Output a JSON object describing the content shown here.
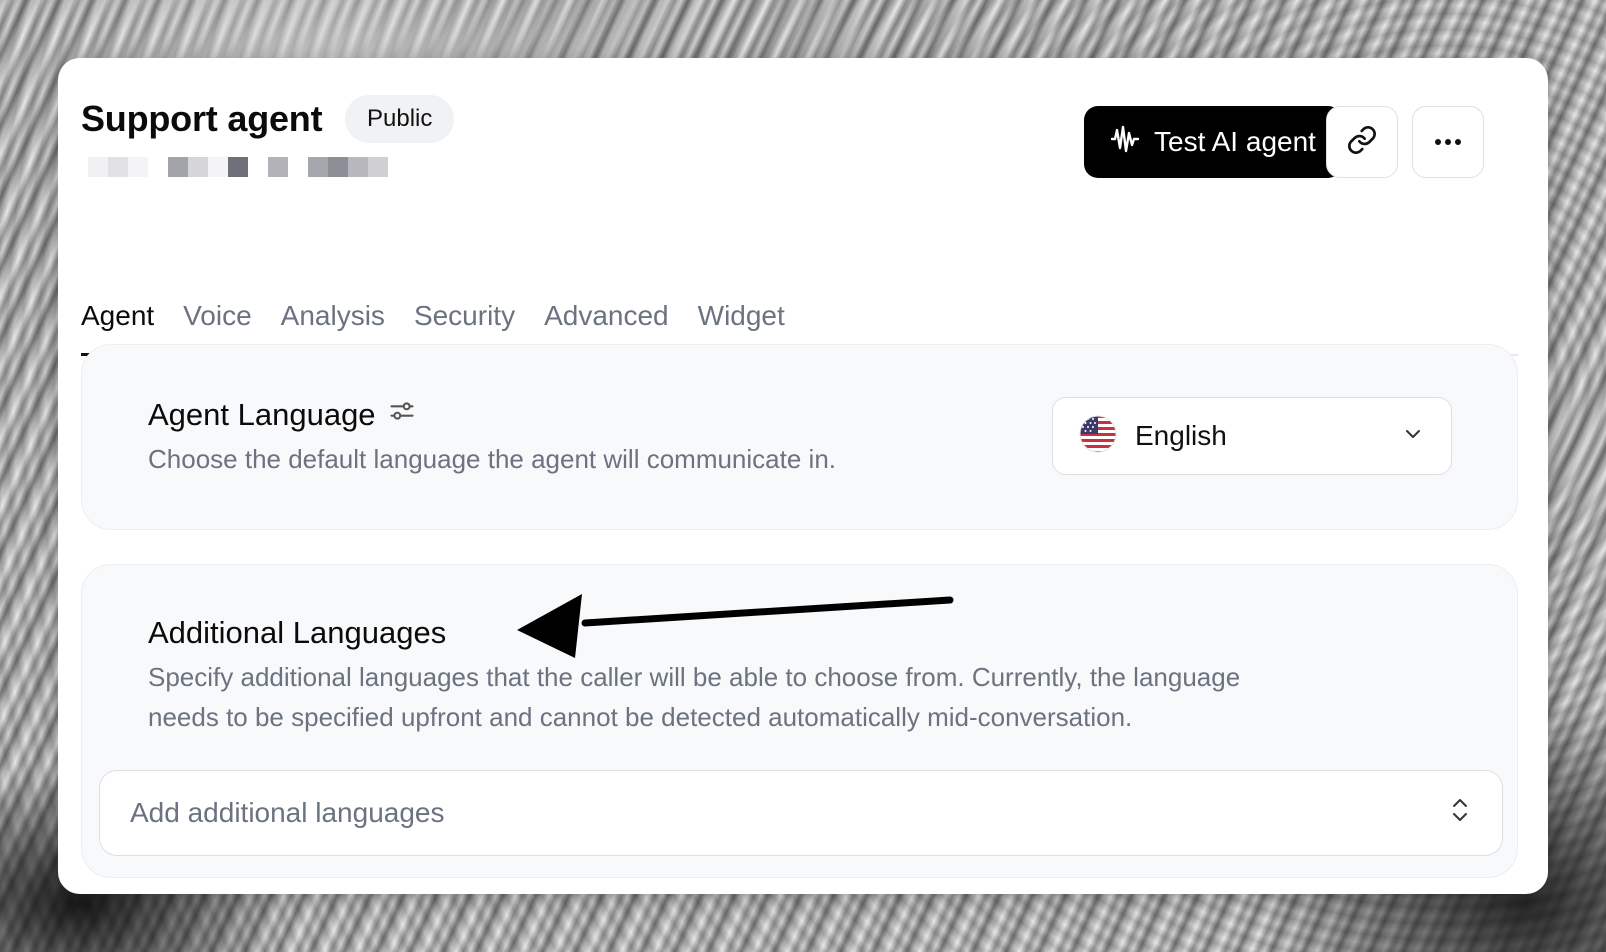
{
  "header": {
    "title": "Support agent",
    "badge": "Public",
    "test_button_label": "Test AI agent"
  },
  "tabs": [
    {
      "label": "Agent",
      "active": true
    },
    {
      "label": "Voice"
    },
    {
      "label": "Analysis"
    },
    {
      "label": "Security"
    },
    {
      "label": "Advanced"
    },
    {
      "label": "Widget"
    }
  ],
  "agent_language": {
    "title": "Agent Language",
    "description": "Choose the default language the agent will communicate in.",
    "selected": "English"
  },
  "additional_languages": {
    "title": "Additional Languages",
    "description_line1": "Specify additional languages that the caller will be able to choose from. Currently, the language",
    "description_line2": "needs to be specified upfront and cannot be detected automatically mid-conversation.",
    "placeholder": "Add additional languages"
  },
  "colors": {
    "accent_dark": "#000000",
    "muted_text": "#6b7280",
    "panel_bg": "#f8f9fb"
  },
  "icons": [
    "waveform-icon",
    "link-icon",
    "more-options-icon",
    "settings-sliders-icon",
    "us-flag-icon",
    "chevron-down-icon",
    "chevron-up-down-icon",
    "annotation-arrow"
  ]
}
